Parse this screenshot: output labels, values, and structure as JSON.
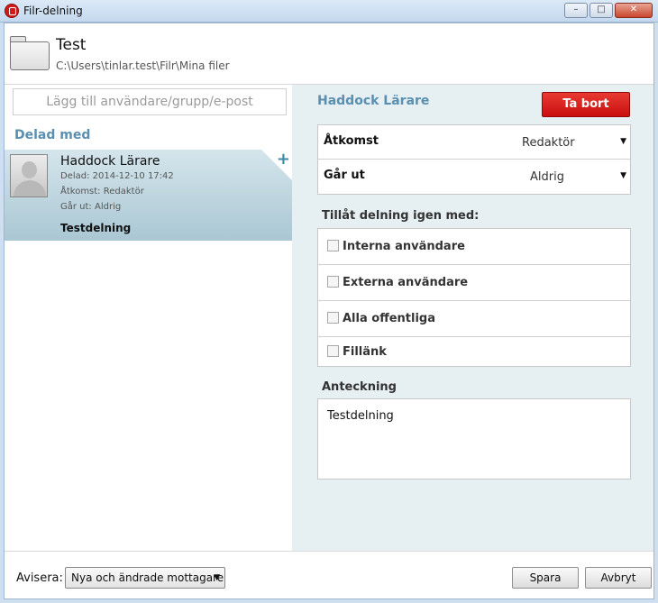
{
  "window": {
    "title": "Filr-delning",
    "minimize": "–",
    "maximize": "□",
    "close": "✕"
  },
  "header": {
    "title": "Test",
    "path": "C:\\Users\\tinlar.test\\Filr\\Mina filer"
  },
  "left": {
    "search_placeholder": "Lägg till användare/grupp/e-post",
    "shared_with_label": "Delad med",
    "item": {
      "name": "Haddock Lärare",
      "shared": "Delad: 2014-12-10 17:42",
      "access_key": "Åtkomst:",
      "access_val": "Redaktör",
      "expires_key": "Går ut:",
      "expires_val": "Aldrig",
      "note": "Testdelning",
      "add_glyph": "+"
    }
  },
  "right": {
    "name": "Haddock Lärare",
    "remove_label": "Ta bort",
    "access": {
      "label": "Åtkomst",
      "value": "Redaktör"
    },
    "expires": {
      "label": "Går ut",
      "value": "Aldrig"
    },
    "reshare_label": "Tillåt delning igen med:",
    "reshare": [
      {
        "label": "Interna användare",
        "checked": false
      },
      {
        "label": "Externa användare",
        "checked": false
      },
      {
        "label": "Alla offentliga",
        "checked": false
      },
      {
        "label": "Fillänk",
        "checked": false
      }
    ],
    "note_label": "Anteckning",
    "note_value": "Testdelning",
    "caret": "▼"
  },
  "footer": {
    "notify_label": "Avisera:",
    "notify_value": "Nya och ändrade mottagare",
    "save_label": "Spara",
    "cancel_label": "Avbryt"
  },
  "colors": {
    "accent": "#5a8fb0",
    "remove": "#d8201d",
    "selected": "#b9d3dd"
  }
}
